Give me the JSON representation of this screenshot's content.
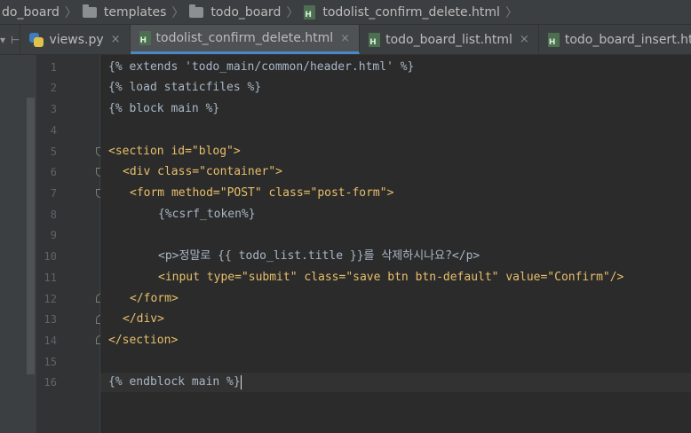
{
  "breadcrumb": [
    {
      "label": "do_board",
      "icon": "none"
    },
    {
      "label": "templates",
      "icon": "folder-icon"
    },
    {
      "label": "todo_board",
      "icon": "folder-icon"
    },
    {
      "label": "todolist_confirm_delete.html",
      "icon": "html-file-icon"
    }
  ],
  "tabs": [
    {
      "label": "views.py",
      "icon": "python-file-icon",
      "active": false
    },
    {
      "label": "todolist_confirm_delete.html",
      "icon": "html-file-icon",
      "active": true
    },
    {
      "label": "todo_board_list.html",
      "icon": "html-file-icon",
      "active": false
    },
    {
      "label": "todo_board_insert.ht",
      "icon": "html-file-icon",
      "active": false
    }
  ],
  "tab_close_glyph": "×",
  "code_lines": [
    {
      "n": "1",
      "text": "{% extends 'todo_main/common/header.html' %}"
    },
    {
      "n": "2",
      "text": "{% load staticfiles %}"
    },
    {
      "n": "3",
      "text": "{% block main %}"
    },
    {
      "n": "4",
      "text": ""
    },
    {
      "n": "5",
      "text": "<section id=\"blog\">"
    },
    {
      "n": "6",
      "text": "<div class=\"container\">"
    },
    {
      "n": "7",
      "text": "<form method=\"POST\" class=\"post-form\">"
    },
    {
      "n": "8",
      "text": "{%csrf_token%}"
    },
    {
      "n": "9",
      "text": ""
    },
    {
      "n": "10",
      "text": "<p>정말로 {{ todo_list.title }}를 삭제하시나요?</p>"
    },
    {
      "n": "11",
      "text": "<input type=\"submit\" class=\"save btn btn-default\" value=\"Confirm\"/>"
    },
    {
      "n": "12",
      "text": "</form>"
    },
    {
      "n": "13",
      "text": "</div>"
    },
    {
      "n": "14",
      "text": "</section>"
    },
    {
      "n": "15",
      "text": ""
    },
    {
      "n": "16",
      "text": "{% endblock main %}"
    }
  ],
  "colors": {
    "tag": "#e8bf6a",
    "attr_value": "#a5c25c",
    "text": "#a9b7c6",
    "active_tab_underline": "#4a88c7"
  }
}
